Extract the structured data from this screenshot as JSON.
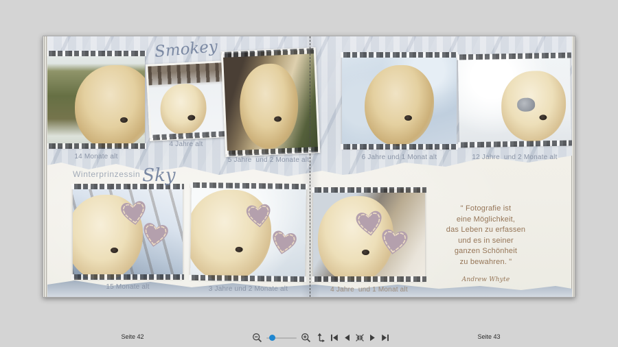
{
  "app": {
    "view": "photo-book-spread-preview",
    "colors": {
      "desktop_background": "#d4d4d4",
      "paper_cream": "#f2efe8",
      "paper_band_blue": "#cdd4de",
      "caption_text": "#8a94a6",
      "quote_text": "#957557",
      "title_script": "#7b89a3",
      "heart_fill": "#b4a0ad",
      "slider_accent": "#1f86d0"
    }
  },
  "pages": {
    "left": {
      "top_title": "Smokey",
      "top_photos": [
        {
          "caption": "14 Monate alt"
        },
        {
          "caption": "4 Jahre alt"
        },
        {
          "caption": "5 Jahre  und 2 Monate alt"
        }
      ],
      "bottom_title": {
        "prefix": "Winterprinzessin",
        "name": "Sky"
      },
      "bottom_photos": [
        {
          "caption": "15 Monate alt"
        },
        {
          "caption": "3 Jahre und 2 Monate alt"
        }
      ]
    },
    "right": {
      "top_photos": [
        {
          "caption": "6 Jahre und 1 Monat alt"
        },
        {
          "caption": "12 Jahre  und 2 Monate alt"
        }
      ],
      "bottom_photos": [
        {
          "caption": "4 Jahre  und 1 Monat alt"
        }
      ],
      "quote": {
        "lines": [
          "\" Fotografie ist",
          "eine Möglichkeit,",
          "das Leben zu erfassen",
          "und es in seiner",
          "ganzen Schönheit",
          "zu bewahren. \""
        ],
        "author": "Andrew Whyte"
      }
    }
  },
  "toolbar": {
    "page_left_label": "Seite 42",
    "page_right_label": "Seite 43",
    "zoom_slider": {
      "position_pct": 10
    },
    "controls": [
      {
        "icon": "zoom-out-icon"
      },
      {
        "icon": "zoom-slider"
      },
      {
        "icon": "zoom-in-icon"
      },
      {
        "icon": "fit-height-icon"
      },
      {
        "icon": "first-page-icon"
      },
      {
        "icon": "previous-page-icon"
      },
      {
        "icon": "fit-spread-icon"
      },
      {
        "icon": "next-page-icon"
      },
      {
        "icon": "last-page-icon"
      }
    ]
  }
}
